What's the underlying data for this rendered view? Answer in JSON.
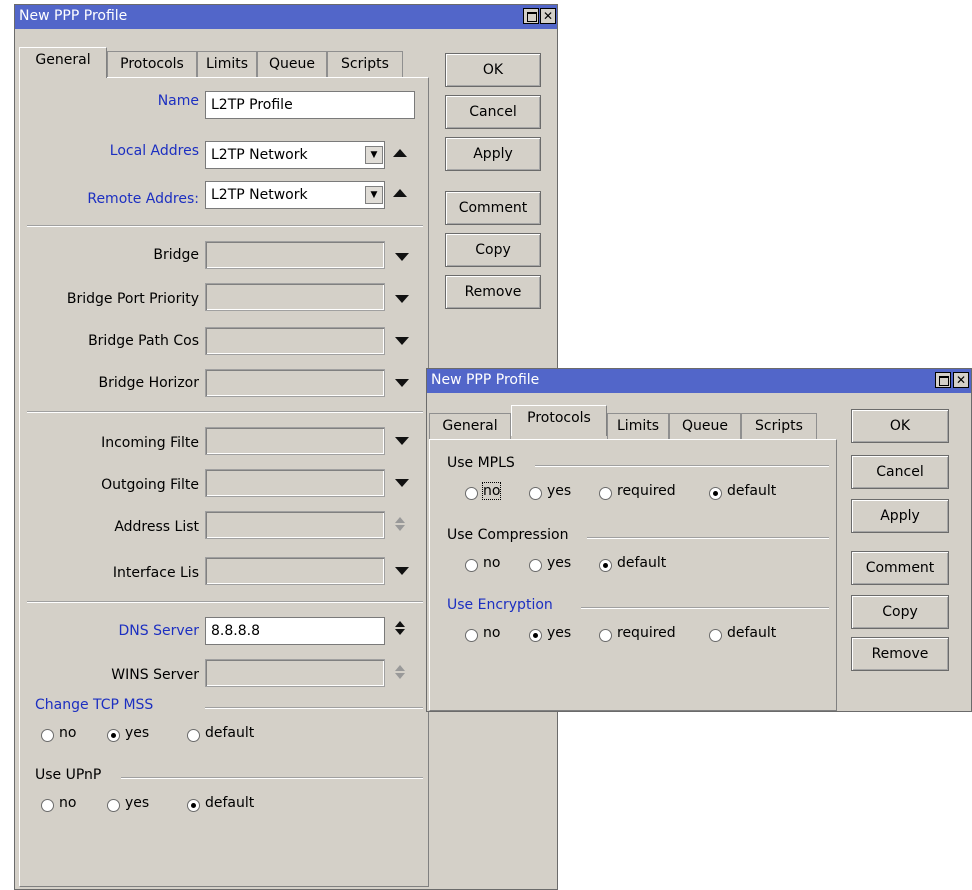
{
  "window1": {
    "title": "New PPP Profile",
    "tabs": [
      "General",
      "Protocols",
      "Limits",
      "Queue",
      "Scripts"
    ],
    "active_tab": "General",
    "fields": {
      "name": {
        "label": "Name",
        "value": "L2TP Profile"
      },
      "local_address": {
        "label": "Local Addres",
        "value": "L2TP Network"
      },
      "remote_address": {
        "label": "Remote Addres:",
        "value": "L2TP Network"
      },
      "bridge": {
        "label": "Bridge",
        "value": ""
      },
      "bridge_port_priority": {
        "label": "Bridge Port Priority",
        "value": ""
      },
      "bridge_path_cost": {
        "label": "Bridge Path Cos",
        "value": ""
      },
      "bridge_horizon": {
        "label": "Bridge Horizor",
        "value": ""
      },
      "incoming_filter": {
        "label": "Incoming Filte",
        "value": ""
      },
      "outgoing_filter": {
        "label": "Outgoing Filte",
        "value": ""
      },
      "address_list": {
        "label": "Address List",
        "value": ""
      },
      "interface_list": {
        "label": "Interface Lis",
        "value": ""
      },
      "dns_server": {
        "label": "DNS Server",
        "value": "8.8.8.8"
      },
      "wins_server": {
        "label": "WINS Server",
        "value": ""
      }
    },
    "change_tcp_mss": {
      "label": "Change TCP MSS",
      "options": [
        "no",
        "yes",
        "default"
      ],
      "selected": "yes"
    },
    "use_upnp": {
      "label": "Use UPnP",
      "options": [
        "no",
        "yes",
        "default"
      ],
      "selected": "default"
    },
    "buttons": {
      "ok": "OK",
      "cancel": "Cancel",
      "apply": "Apply",
      "comment": "Comment",
      "copy": "Copy",
      "remove": "Remove"
    }
  },
  "window2": {
    "title": "New PPP Profile",
    "tabs": [
      "General",
      "Protocols",
      "Limits",
      "Queue",
      "Scripts"
    ],
    "active_tab": "Protocols",
    "use_mpls": {
      "label": "Use MPLS",
      "options": [
        "no",
        "yes",
        "required",
        "default"
      ],
      "selected": "default"
    },
    "use_compression": {
      "label": "Use Compression",
      "options": [
        "no",
        "yes",
        "default"
      ],
      "selected": "default"
    },
    "use_encryption": {
      "label": "Use Encryption",
      "options": [
        "no",
        "yes",
        "required",
        "default"
      ],
      "selected": "yes"
    },
    "buttons": {
      "ok": "OK",
      "cancel": "Cancel",
      "apply": "Apply",
      "comment": "Comment",
      "copy": "Copy",
      "remove": "Remove"
    }
  },
  "icons": {
    "maximize": "maximize-icon",
    "close": "close-icon",
    "dropdown": "dropdown-arrow-icon",
    "up": "up-arrow-icon",
    "updown": "up-down-arrows-icon"
  },
  "colors": {
    "titlebar": "#5266c9",
    "window_bg": "#d4d0c8",
    "blue_label": "#1c2fc1"
  }
}
